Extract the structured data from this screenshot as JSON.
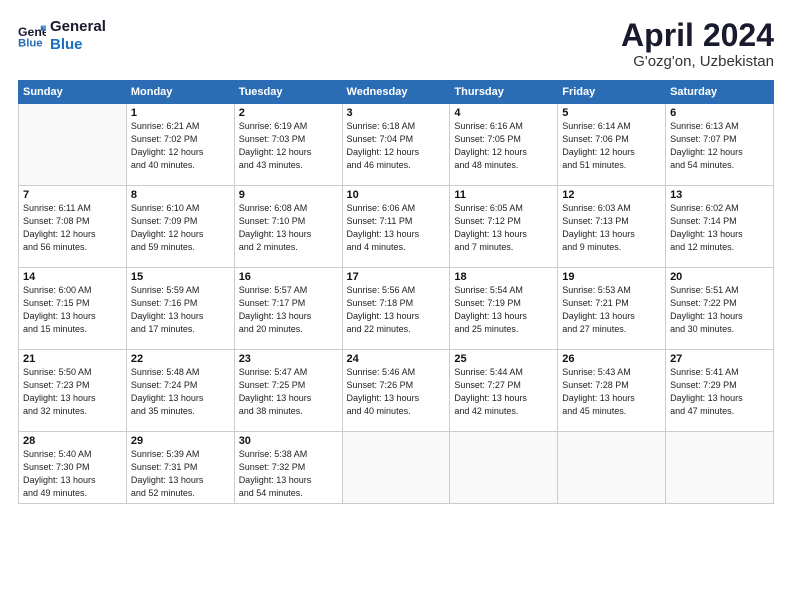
{
  "header": {
    "logo_line1": "General",
    "logo_line2": "Blue",
    "main_title": "April 2024",
    "subtitle": "G'ozg'on, Uzbekistan"
  },
  "weekdays": [
    "Sunday",
    "Monday",
    "Tuesday",
    "Wednesday",
    "Thursday",
    "Friday",
    "Saturday"
  ],
  "weeks": [
    [
      {
        "day": null
      },
      {
        "day": "1",
        "sunrise": "6:21 AM",
        "sunset": "7:02 PM",
        "daylight": "12 hours and 40 minutes."
      },
      {
        "day": "2",
        "sunrise": "6:19 AM",
        "sunset": "7:03 PM",
        "daylight": "12 hours and 43 minutes."
      },
      {
        "day": "3",
        "sunrise": "6:18 AM",
        "sunset": "7:04 PM",
        "daylight": "12 hours and 46 minutes."
      },
      {
        "day": "4",
        "sunrise": "6:16 AM",
        "sunset": "7:05 PM",
        "daylight": "12 hours and 48 minutes."
      },
      {
        "day": "5",
        "sunrise": "6:14 AM",
        "sunset": "7:06 PM",
        "daylight": "12 hours and 51 minutes."
      },
      {
        "day": "6",
        "sunrise": "6:13 AM",
        "sunset": "7:07 PM",
        "daylight": "12 hours and 54 minutes."
      }
    ],
    [
      {
        "day": "7",
        "sunrise": "6:11 AM",
        "sunset": "7:08 PM",
        "daylight": "12 hours and 56 minutes."
      },
      {
        "day": "8",
        "sunrise": "6:10 AM",
        "sunset": "7:09 PM",
        "daylight": "12 hours and 59 minutes."
      },
      {
        "day": "9",
        "sunrise": "6:08 AM",
        "sunset": "7:10 PM",
        "daylight": "13 hours and 2 minutes."
      },
      {
        "day": "10",
        "sunrise": "6:06 AM",
        "sunset": "7:11 PM",
        "daylight": "13 hours and 4 minutes."
      },
      {
        "day": "11",
        "sunrise": "6:05 AM",
        "sunset": "7:12 PM",
        "daylight": "13 hours and 7 minutes."
      },
      {
        "day": "12",
        "sunrise": "6:03 AM",
        "sunset": "7:13 PM",
        "daylight": "13 hours and 9 minutes."
      },
      {
        "day": "13",
        "sunrise": "6:02 AM",
        "sunset": "7:14 PM",
        "daylight": "13 hours and 12 minutes."
      }
    ],
    [
      {
        "day": "14",
        "sunrise": "6:00 AM",
        "sunset": "7:15 PM",
        "daylight": "13 hours and 15 minutes."
      },
      {
        "day": "15",
        "sunrise": "5:59 AM",
        "sunset": "7:16 PM",
        "daylight": "13 hours and 17 minutes."
      },
      {
        "day": "16",
        "sunrise": "5:57 AM",
        "sunset": "7:17 PM",
        "daylight": "13 hours and 20 minutes."
      },
      {
        "day": "17",
        "sunrise": "5:56 AM",
        "sunset": "7:18 PM",
        "daylight": "13 hours and 22 minutes."
      },
      {
        "day": "18",
        "sunrise": "5:54 AM",
        "sunset": "7:19 PM",
        "daylight": "13 hours and 25 minutes."
      },
      {
        "day": "19",
        "sunrise": "5:53 AM",
        "sunset": "7:21 PM",
        "daylight": "13 hours and 27 minutes."
      },
      {
        "day": "20",
        "sunrise": "5:51 AM",
        "sunset": "7:22 PM",
        "daylight": "13 hours and 30 minutes."
      }
    ],
    [
      {
        "day": "21",
        "sunrise": "5:50 AM",
        "sunset": "7:23 PM",
        "daylight": "13 hours and 32 minutes."
      },
      {
        "day": "22",
        "sunrise": "5:48 AM",
        "sunset": "7:24 PM",
        "daylight": "13 hours and 35 minutes."
      },
      {
        "day": "23",
        "sunrise": "5:47 AM",
        "sunset": "7:25 PM",
        "daylight": "13 hours and 38 minutes."
      },
      {
        "day": "24",
        "sunrise": "5:46 AM",
        "sunset": "7:26 PM",
        "daylight": "13 hours and 40 minutes."
      },
      {
        "day": "25",
        "sunrise": "5:44 AM",
        "sunset": "7:27 PM",
        "daylight": "13 hours and 42 minutes."
      },
      {
        "day": "26",
        "sunrise": "5:43 AM",
        "sunset": "7:28 PM",
        "daylight": "13 hours and 45 minutes."
      },
      {
        "day": "27",
        "sunrise": "5:41 AM",
        "sunset": "7:29 PM",
        "daylight": "13 hours and 47 minutes."
      }
    ],
    [
      {
        "day": "28",
        "sunrise": "5:40 AM",
        "sunset": "7:30 PM",
        "daylight": "13 hours and 49 minutes."
      },
      {
        "day": "29",
        "sunrise": "5:39 AM",
        "sunset": "7:31 PM",
        "daylight": "13 hours and 52 minutes."
      },
      {
        "day": "30",
        "sunrise": "5:38 AM",
        "sunset": "7:32 PM",
        "daylight": "13 hours and 54 minutes."
      },
      {
        "day": null
      },
      {
        "day": null
      },
      {
        "day": null
      },
      {
        "day": null
      }
    ]
  ]
}
